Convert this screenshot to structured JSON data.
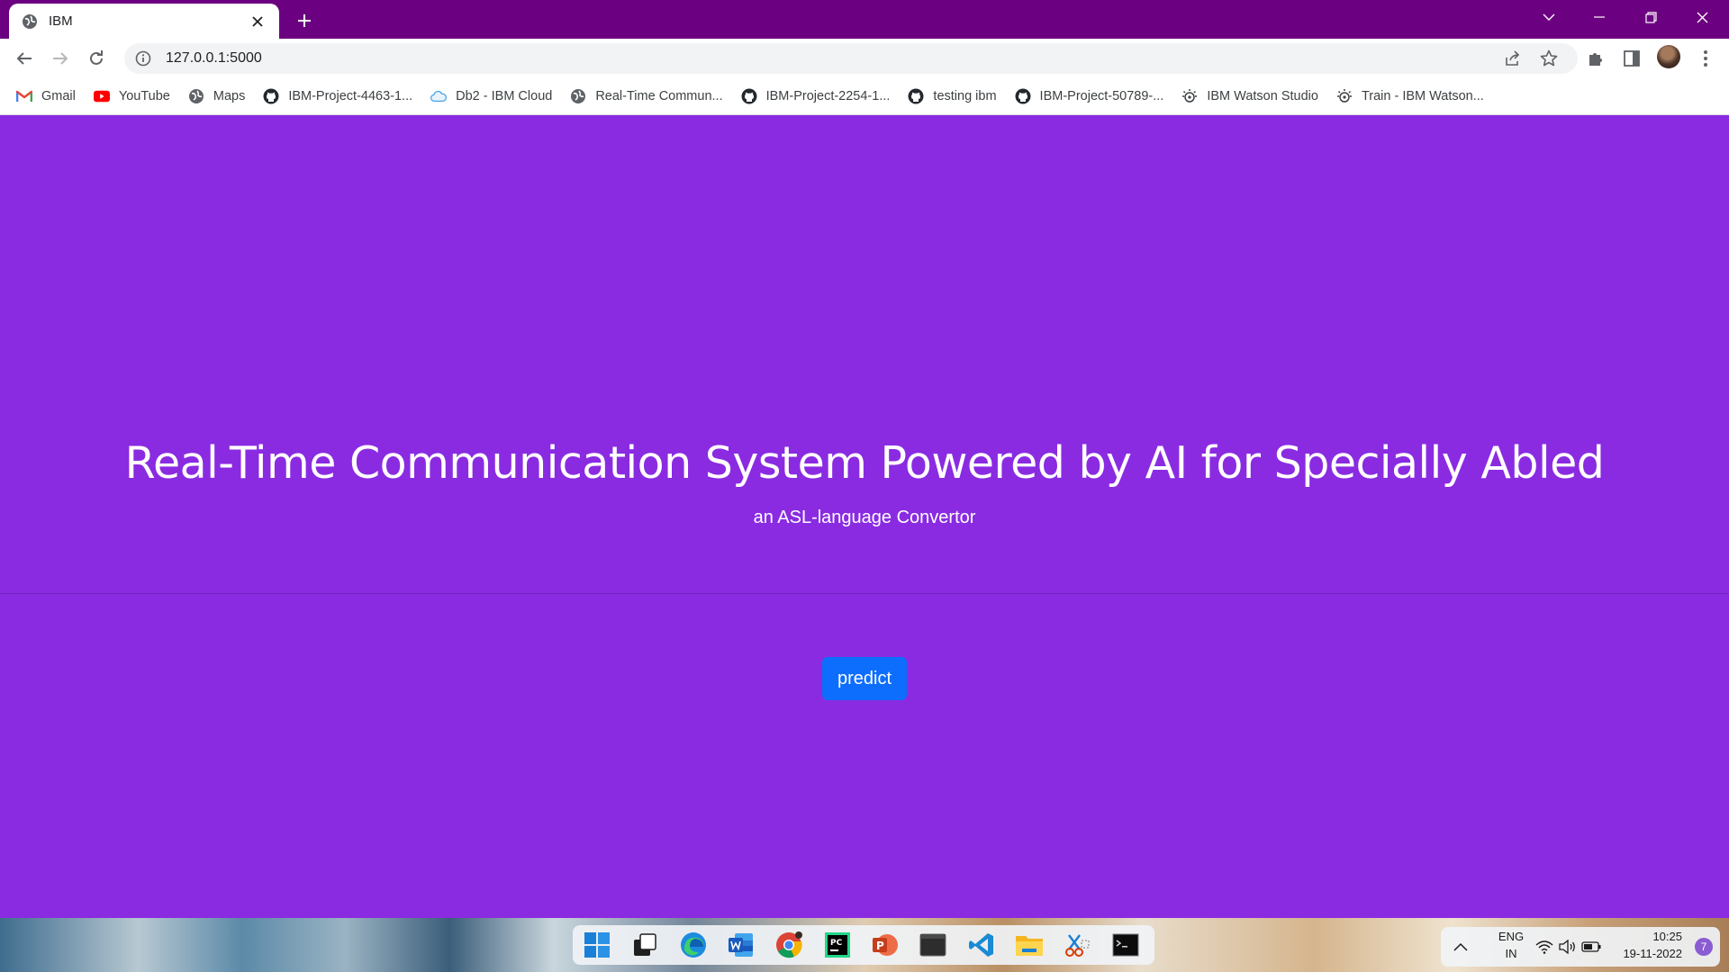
{
  "browser": {
    "tab_title": "IBM",
    "url": "127.0.0.1:5000",
    "bookmarks": [
      {
        "label": "Gmail",
        "icon": "gmail-icon"
      },
      {
        "label": "YouTube",
        "icon": "youtube-icon"
      },
      {
        "label": "Maps",
        "icon": "globe-icon"
      },
      {
        "label": "IBM-Project-4463-1...",
        "icon": "github-icon"
      },
      {
        "label": "Db2 - IBM Cloud",
        "icon": "cloud-icon"
      },
      {
        "label": "Real-Time Commun...",
        "icon": "globe-icon"
      },
      {
        "label": "IBM-Project-2254-1...",
        "icon": "github-icon"
      },
      {
        "label": "testing ibm",
        "icon": "github-icon"
      },
      {
        "label": "IBM-Project-50789-...",
        "icon": "github-icon"
      },
      {
        "label": "IBM Watson Studio",
        "icon": "watson-icon"
      },
      {
        "label": "Train - IBM Watson...",
        "icon": "watson-icon"
      }
    ]
  },
  "page": {
    "title": "Real-Time Communication System Powered by AI for Specially Abled",
    "subtitle": "an ASL-language Convertor",
    "predict_label": "predict"
  },
  "taskbar": {
    "apps": [
      "start-icon",
      "task-view-icon",
      "edge-icon",
      "word-icon",
      "chrome-icon",
      "pycharm-icon",
      "powerpoint-icon",
      "terminal-icon",
      "vscode-icon",
      "file-explorer-icon",
      "snipping-tool-icon",
      "command-prompt-icon"
    ],
    "lang_line1": "ENG",
    "lang_line2": "IN",
    "time": "10:25",
    "date": "19-11-2022",
    "notifications": "7"
  },
  "colors": {
    "page_background": "#8a2be2",
    "tab_strip": "#6b0080",
    "button": "#0d6efd"
  }
}
